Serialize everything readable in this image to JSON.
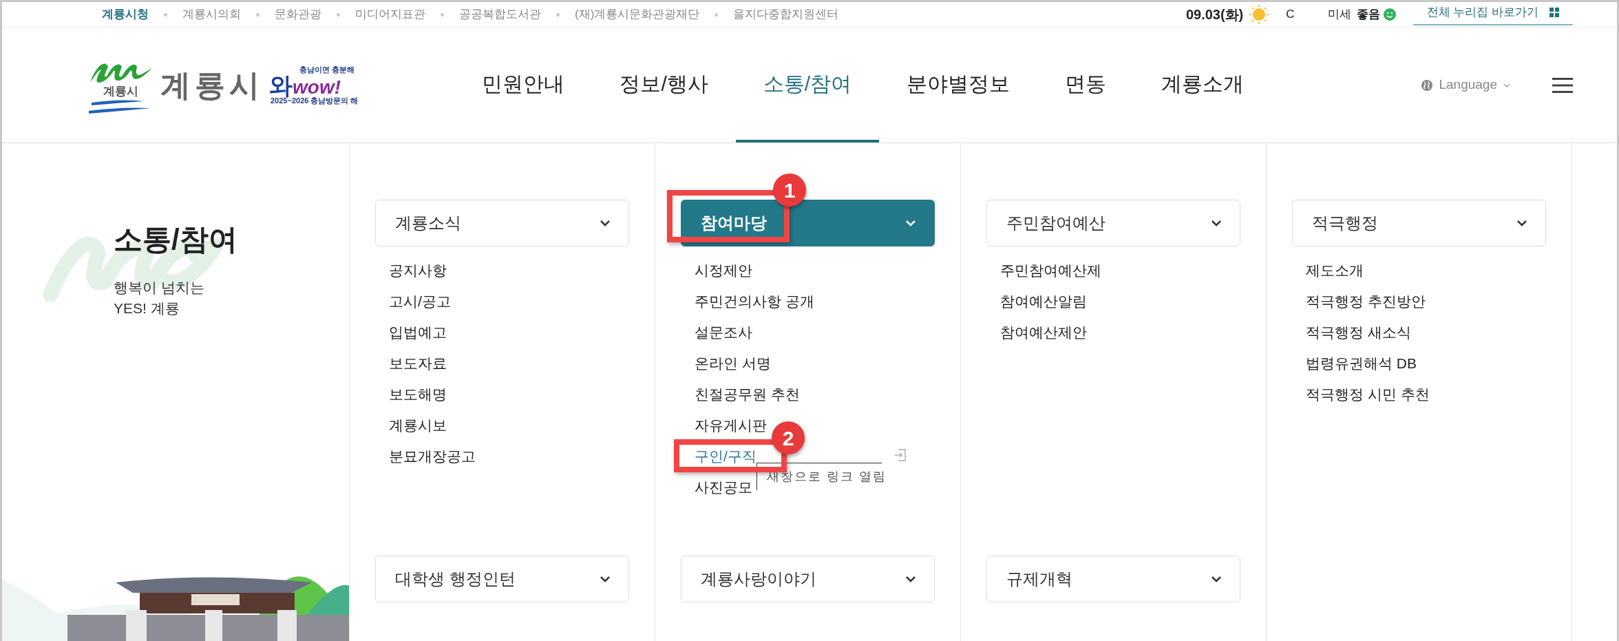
{
  "top_bar": {
    "sites": [
      {
        "label": "계룡시청",
        "selected": true
      },
      {
        "label": "계룡시의회",
        "selected": false
      },
      {
        "label": "문화관광",
        "selected": false
      },
      {
        "label": "미디어지표관",
        "selected": false
      },
      {
        "label": "공공복합도서관",
        "selected": false
      },
      {
        "label": "(재)계룡시문화관광재단",
        "selected": false
      },
      {
        "label": "을지다중합지원센터",
        "selected": false
      }
    ],
    "date": "09.03(화)",
    "temperature_unit": "C",
    "dust_label": "미세",
    "dust_status": "좋음",
    "all_sites_link": "전체 누리집 바로가기"
  },
  "logo": {
    "emblem_text": "계룡시",
    "name": "계룡시",
    "slogan_top": "충남이면 충분해",
    "slogan_wa": "와",
    "slogan_wow": "wow!",
    "slogan_bottom": "2025~2026 충남방문의 해"
  },
  "nav": [
    {
      "label": "민원안내",
      "selected": false
    },
    {
      "label": "정보/행사",
      "selected": false
    },
    {
      "label": "소통/참여",
      "selected": true
    },
    {
      "label": "분야별정보",
      "selected": false
    },
    {
      "label": "면동",
      "selected": false
    },
    {
      "label": "계룡소개",
      "selected": false
    }
  ],
  "language": "Language",
  "section": {
    "title": "소통/참여",
    "subtitle_lines": [
      "행복이 넘치는",
      "YES! 계룡"
    ]
  },
  "columns": [
    {
      "header": {
        "label": "계룡소식",
        "selected": false
      },
      "items": [
        {
          "label": "공지사항",
          "selected": false
        },
        {
          "label": "고시/공고",
          "selected": false
        },
        {
          "label": "입법예고",
          "selected": false
        },
        {
          "label": "보도자료",
          "selected": false
        },
        {
          "label": "보도해명",
          "selected": false
        },
        {
          "label": "계룡시보",
          "selected": false
        },
        {
          "label": "분묘개장공고",
          "selected": false
        }
      ],
      "footer": {
        "label": "대학생 행정인턴"
      }
    },
    {
      "header": {
        "label": "참여마당",
        "selected": true,
        "callout": "1"
      },
      "items": [
        {
          "label": "시정제안",
          "selected": false
        },
        {
          "label": "주민건의사항 공개",
          "selected": false
        },
        {
          "label": "설문조사",
          "selected": false
        },
        {
          "label": "온라인 서명",
          "selected": false
        },
        {
          "label": "친절공무원 추천",
          "selected": false
        },
        {
          "label": "자유게시판",
          "selected": false
        },
        {
          "label": "구인/구직",
          "selected": true,
          "callout": "2",
          "new_window": true,
          "tooltip": "새창으로 링크 열림"
        },
        {
          "label": "사진공모",
          "selected": false
        }
      ],
      "footer": {
        "label": "계룡사랑이야기"
      }
    },
    {
      "header": {
        "label": "주민참여예산",
        "selected": false
      },
      "items": [
        {
          "label": "주민참여예산제",
          "selected": false
        },
        {
          "label": "참여예산알림",
          "selected": false
        },
        {
          "label": "참여예산제안",
          "selected": false
        }
      ],
      "footer": {
        "label": "규제개혁"
      }
    },
    {
      "header": {
        "label": "적극행정",
        "selected": false
      },
      "items": [
        {
          "label": "제도소개",
          "selected": false
        },
        {
          "label": "적극행정 추진방안",
          "selected": false
        },
        {
          "label": "적극행정 새소식",
          "selected": false
        },
        {
          "label": "법령유권해석 DB",
          "selected": false
        },
        {
          "label": "적극행정 시민 추천",
          "selected": false
        }
      ]
    }
  ]
}
